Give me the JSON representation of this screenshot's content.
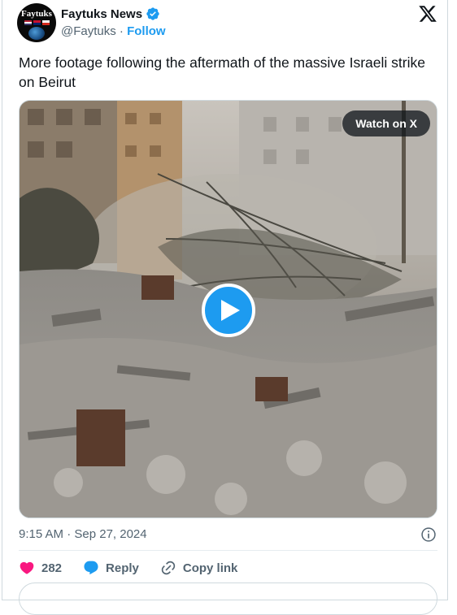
{
  "author": {
    "name": "Faytuks News",
    "handle": "@Faytuks",
    "separator": "·",
    "follow_label": "Follow",
    "avatar_text": "Faytuks"
  },
  "tweet": {
    "text": "More footage following the aftermath of the massive Israeli strike on Beirut",
    "timestamp": "9:15 AM · Sep 27, 2024"
  },
  "media": {
    "watch_label": "Watch on X",
    "type": "video"
  },
  "actions": {
    "likes_count": "282",
    "reply_label": "Reply",
    "copy_label": "Copy link"
  },
  "colors": {
    "accent": "#1d9bf0",
    "like": "#f91880",
    "text": "#0f1419",
    "muted": "#536471"
  }
}
